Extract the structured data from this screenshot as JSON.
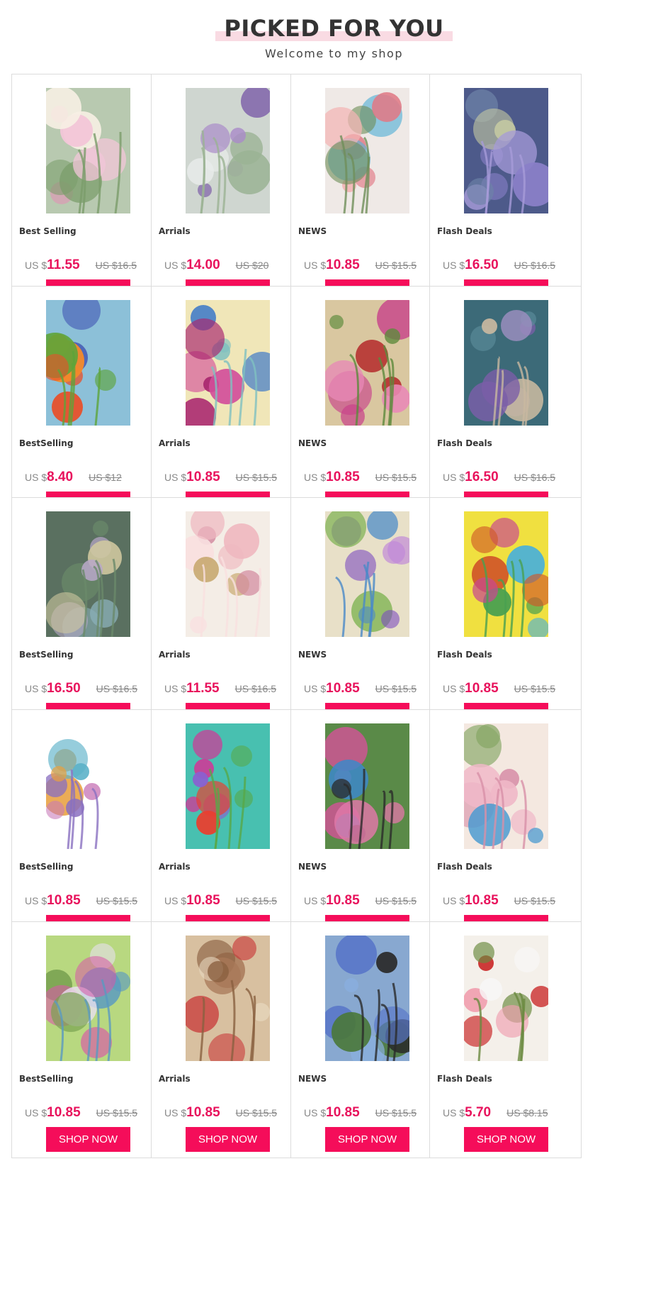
{
  "header": {
    "title": "PICKED FOR YOU",
    "subtitle": "Welcome to my shop"
  },
  "currency_prefix": "US $",
  "button_label": "SHOP NOW",
  "colors": {
    "accent": "#f50d5a",
    "price": "#e8125c",
    "title_bar": "#f9dbe3"
  },
  "products": [
    {
      "label": "Best Selling",
      "price": "11.55",
      "old": "US $16.5",
      "image": "lily-bouquet-painting"
    },
    {
      "label": "Arrials",
      "price": "14.00",
      "old": "US $20",
      "image": "purple-flowers-vase-painting"
    },
    {
      "label": "NEWS",
      "price": "10.85",
      "old": "US $15.5",
      "image": "butterfly-roses-painting"
    },
    {
      "label": "Flash Deals",
      "price": "16.50",
      "old": "US $16.5",
      "image": "lotus-pond-painting"
    },
    {
      "label": "BestSelling",
      "price": "8.40",
      "old": "US $12",
      "image": "butterflies-gerbera-painting"
    },
    {
      "label": "Arrials",
      "price": "10.85",
      "old": "US $15.5",
      "image": "butterfly-magenta-bloom-painting"
    },
    {
      "label": "NEWS",
      "price": "10.85",
      "old": "US $15.5",
      "image": "pink-lilies-painting"
    },
    {
      "label": "Flash Deals",
      "price": "16.50",
      "old": "US $16.5",
      "image": "dragonfly-iris-painting"
    },
    {
      "label": "BestSelling",
      "price": "16.50",
      "old": "US $16.5",
      "image": "dragonfly-pond-painting"
    },
    {
      "label": "Arrials",
      "price": "11.55",
      "old": "US $16.5",
      "image": "pink-stem-flowers-painting"
    },
    {
      "label": "NEWS",
      "price": "10.85",
      "old": "US $15.5",
      "image": "hummingbirds-petunias-painting"
    },
    {
      "label": "Flash Deals",
      "price": "10.85",
      "old": "US $15.5",
      "image": "lion-butterflies-painting"
    },
    {
      "label": "BestSelling",
      "price": "10.85",
      "old": "US $15.5",
      "image": "lion-butterfly-mosaic-painting"
    },
    {
      "label": "Arrials",
      "price": "10.85",
      "old": "US $15.5",
      "image": "hummingbird-hibiscus-painting"
    },
    {
      "label": "NEWS",
      "price": "10.85",
      "old": "US $15.5",
      "image": "butterflies-orchids-painting"
    },
    {
      "label": "Flash Deals",
      "price": "10.85",
      "old": "US $15.5",
      "image": "bluebirds-blossoms-painting"
    },
    {
      "label": "BestSelling",
      "price": "10.85",
      "old": "US $15.5",
      "image": "butterflies-orchid-garden-painting"
    },
    {
      "label": "Arrials",
      "price": "10.85",
      "old": "US $15.5",
      "image": "deer-roses-painting"
    },
    {
      "label": "NEWS",
      "price": "10.85",
      "old": "US $15.5",
      "image": "chickadees-lilac-painting"
    },
    {
      "label": "Flash Deals",
      "price": "5.70",
      "old": "US $8.15",
      "image": "cardinal-blossoms-painting"
    }
  ]
}
